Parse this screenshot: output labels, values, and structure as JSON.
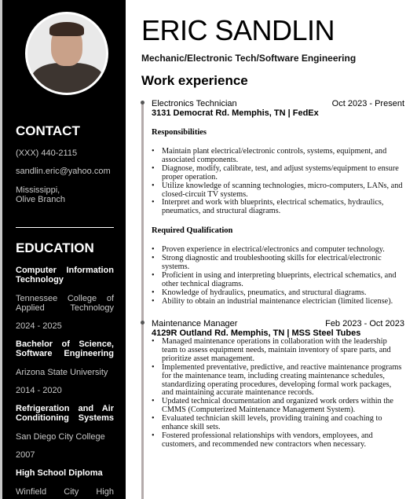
{
  "header": {
    "name": "ERIC SANDLIN",
    "subtitle": "Mechanic/Electronic Tech/Software Engineering"
  },
  "sidebar": {
    "contact_heading": "CONTACT",
    "phone": "(XXX) 440-2115",
    "email": "sandlin.eric@yahoo.com",
    "location_line1": "Mississippi,",
    "location_line2": "Olive Branch",
    "education_heading": "EDUCATION",
    "education": [
      {
        "title": "Computer Information Technology",
        "school": "Tennessee College of Applied Technology",
        "years": "2024 - 2025"
      },
      {
        "title": "Bachelor of Science, Software Engineering",
        "school": "Arizona State University",
        "years": "2014 - 2020"
      },
      {
        "title": "Refrigeration and Air Conditioning Systems",
        "school": "San Diego City College",
        "years": "2007"
      },
      {
        "title": "High School Diploma",
        "school": "Winfield City High"
      }
    ]
  },
  "work": {
    "heading": "Work experience",
    "jobs": [
      {
        "title": "Electronics Technician",
        "dates": "Oct 2023 - Present",
        "location": "3131 Democrat Rd. Memphis, TN | FedEx",
        "resp_heading": "Responsibilities",
        "responsibilities": [
          "Maintain plant electrical/electronic controls, systems, equipment, and associated components.",
          "Diagnose, modify, calibrate, test, and adjust systems/equipment to ensure proper operation.",
          "Utilize knowledge of scanning technologies, micro-computers, LANs, and closed-circuit TV systems.",
          "Interpret and work with blueprints, electrical schematics, hydraulics, pneumatics, and structural diagrams."
        ],
        "qual_heading": "Required Qualification",
        "qualifications": [
          "Proven experience in electrical/electronics and computer technology.",
          "Strong diagnostic and troubleshooting skills for electrical/electronic systems.",
          "Proficient in using and interpreting blueprints, electrical schematics, and other technical diagrams.",
          "Knowledge of hydraulics, pneumatics, and structural diagrams.",
          "Ability to obtain an industrial maintenance electrician (limited license)."
        ]
      },
      {
        "title": "Maintenance Manager",
        "dates": "Feb 2023 - Oct 2023",
        "location": "4129R Outland Rd. Memphis, TN | MSS Steel Tubes",
        "bullets": [
          "Managed maintenance operations in collaboration with the leadership team to assess equipment needs, maintain inventory of spare parts, and prioritize asset management.",
          "Implemented preventative, predictive, and reactive maintenance programs for the maintenance team, including creating maintenance schedules, standardizing operating procedures, developing formal work packages, and maintaining accurate maintenance records.",
          "Updated technical documentation and organized work orders within the CMMS (Computerized Maintenance Management System).",
          "Evaluated technician skill levels, providing training and coaching to enhance skill sets.",
          "Fostered professional relationships with vendors, employees, and customers, and recommended new contractors when necessary."
        ]
      }
    ]
  }
}
